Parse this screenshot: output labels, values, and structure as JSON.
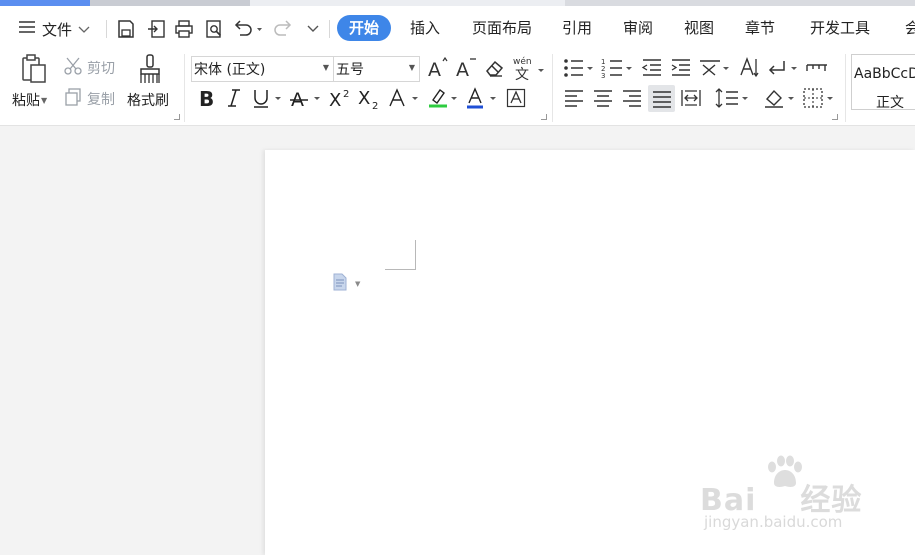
{
  "menu": {
    "file_label": "文件",
    "tabs": [
      {
        "label": "开始",
        "active": true
      },
      {
        "label": "插入"
      },
      {
        "label": "页面布局"
      },
      {
        "label": "引用"
      },
      {
        "label": "审阅"
      },
      {
        "label": "视图"
      },
      {
        "label": "章节"
      },
      {
        "label": "开发工具"
      },
      {
        "label": "会"
      }
    ]
  },
  "ribbon": {
    "clipboard": {
      "paste_label": "粘贴",
      "cut_label": "剪切",
      "copy_label": "复制",
      "format_painter_label": "格式刷"
    },
    "font": {
      "font_name": "宋体 (正文)",
      "font_size": "五号",
      "phonetic_glyph": "wén"
    },
    "styles": {
      "preview_text": "AaBbCcD",
      "style_name": "正文"
    }
  },
  "watermark": {
    "brand": "Bai",
    "brand_cn": "经验",
    "url": "jingyan.baidu.com"
  },
  "colors": {
    "accent": "#3e86e8",
    "highlight_bar": "#2ecc40",
    "font_color_bar": "#1f4fd6"
  }
}
